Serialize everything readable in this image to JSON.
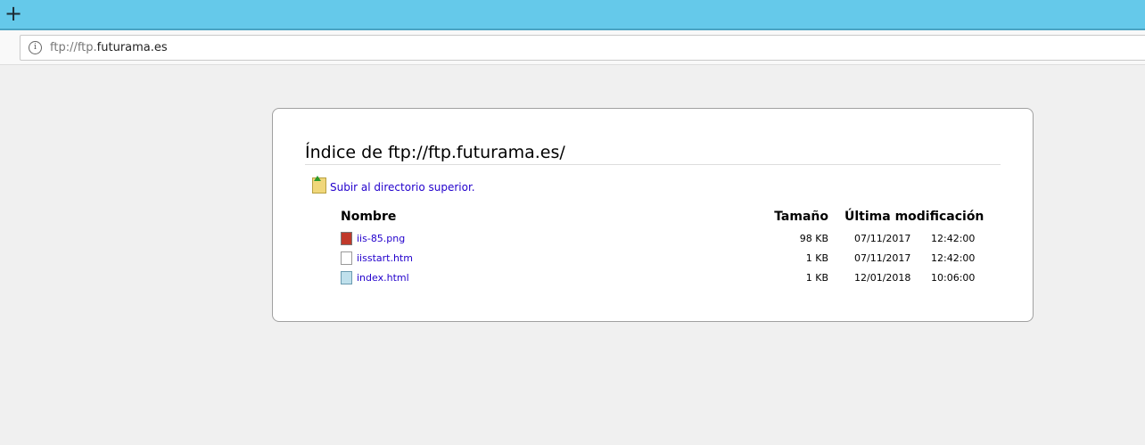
{
  "browser": {
    "url_prefix": "ftp://ftp.",
    "url_domain": "futurama.es"
  },
  "page": {
    "title": "Índice de ftp://ftp.futurama.es/",
    "parent_link": "Subir al directorio superior.",
    "columns": {
      "name": "Nombre",
      "size": "Tamaño",
      "modified": "Última modificación"
    },
    "files": [
      {
        "name": "iis-85.png",
        "icon": "image-file-icon",
        "size": "98 KB",
        "date": "07/11/2017",
        "time": "12:42:00"
      },
      {
        "name": "iisstart.htm",
        "icon": "text-file-icon",
        "size": "1 KB",
        "date": "07/11/2017",
        "time": "12:42:00"
      },
      {
        "name": "index.html",
        "icon": "html-file-icon",
        "size": "1 KB",
        "date": "12/01/2018",
        "time": "10:06:00"
      }
    ]
  }
}
